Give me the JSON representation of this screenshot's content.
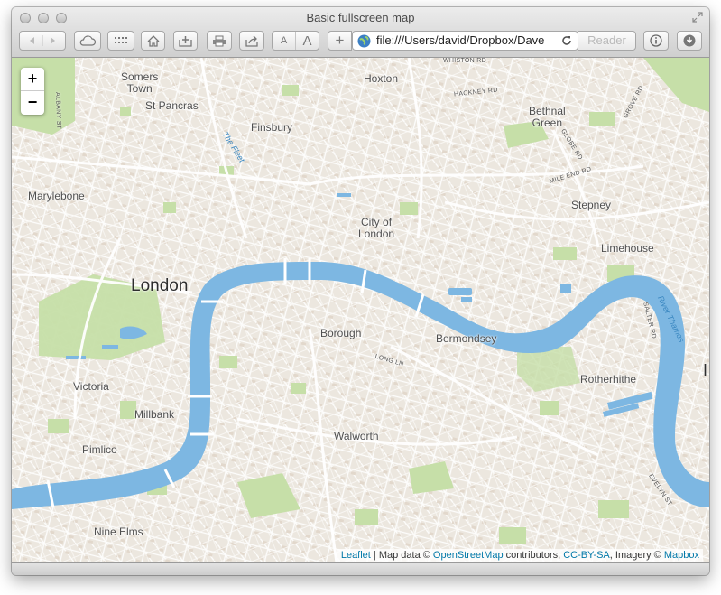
{
  "window": {
    "title": "Basic fullscreen map"
  },
  "toolbar": {
    "url": "file:///Users/david/Dropbox/Dave",
    "reader_label": "Reader",
    "font_small": "A",
    "font_large": "A",
    "add_label": "+"
  },
  "map": {
    "zoom_in": "+",
    "zoom_out": "−",
    "places": {
      "somers_town": "Somers\nTown",
      "hoxton": "Hoxton",
      "st_pancras": "St Pancras",
      "finsbury": "Finsbury",
      "bethnal_green": "Bethnal\nGreen",
      "marylebone": "Marylebone",
      "city_of_london": "City of\nLondon",
      "stepney": "Stepney",
      "limehouse": "Limehouse",
      "london": "London",
      "borough": "Borough",
      "bermondsey": "Bermondsey",
      "victoria": "Victoria",
      "rotherhithe": "Rotherhithe",
      "millbank": "Millbank",
      "walworth": "Walworth",
      "pimlico": "Pimlico",
      "nine_elms": "Nine Elms",
      "i_edge": "I"
    },
    "roads": {
      "albany_st": "ALBANY ST",
      "whiston_rd": "WHISTON RD",
      "hackney_rd": "HACKNEY RD",
      "grove_rd": "GROVE RD",
      "globe_rd": "GLOBE RD",
      "mile_end_rd": "MILE END RD",
      "long_ln": "LONG LN",
      "salter_rd": "SALTER RD",
      "evelyn_st": "EVELYN ST"
    },
    "water": {
      "the_fleet": "The Fleet",
      "river_thames": "River Thames"
    },
    "attribution": {
      "leaflet": "Leaflet",
      "sep": " | Map data © ",
      "osm": "OpenStreetMap",
      "contributors": " contributors, ",
      "license": "CC-BY-SA",
      "imagery": ", Imagery © ",
      "mapbox": "Mapbox"
    }
  },
  "colors": {
    "water": "#7db7e2",
    "park": "#c6dfa8",
    "land": "#ece7df",
    "link": "#0078a8"
  }
}
